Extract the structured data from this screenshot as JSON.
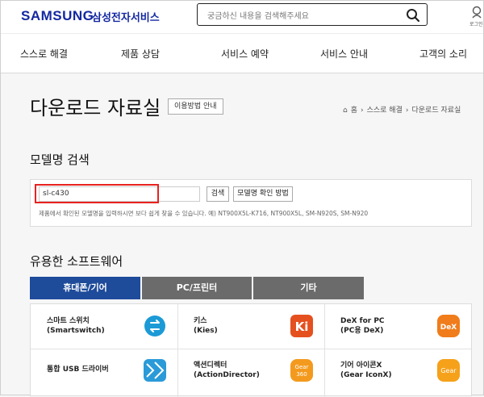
{
  "header": {
    "logo": "SAMSUNG",
    "logo_sub": "삼성전자서비스",
    "search_placeholder": "궁금하신 내용을 검색해주세요",
    "user_label": "로그인"
  },
  "nav": [
    "스스로 해결",
    "제품 상담",
    "서비스 예약",
    "서비스 안내",
    "고객의 소리"
  ],
  "page": {
    "title": "다운로드 자료실",
    "guide_button": "이용방법 안내",
    "breadcrumb": [
      "홈",
      "스스로 해결",
      "다운로드 자료실"
    ]
  },
  "model_search": {
    "title": "모델명 검색",
    "input_value": "sl-c430",
    "search_button": "검색",
    "check_button": "모델명 확인 방법",
    "hint": "제품에서 확인된 모델명을 입력하시면 보다 쉽게 찾을 수 있습니다. 예) NT900X5L-K716, NT900X5L, SM-N920S, SM-N920"
  },
  "software": {
    "title": "유용한 소프트웨어",
    "tabs": [
      "휴대폰/기어",
      "PC/프린터",
      "기타"
    ],
    "items": [
      {
        "name": "스마트 스위치\n(Smartswitch)",
        "icon": "smartswitch-icon",
        "color": "#1b9ad6"
      },
      {
        "name": "키스\n(Kies)",
        "icon": "kies-icon",
        "color": "#e5501f"
      },
      {
        "name": "DeX for PC\n(PC용 DeX)",
        "icon": "dex-icon",
        "color": "#f07c1b"
      },
      {
        "name": "통합 USB 드라이버",
        "icon": "usb-driver-icon",
        "color": "#1a8fd0"
      },
      {
        "name": "액션디렉터\n(ActionDirector)",
        "icon": "gear360-icon",
        "color": "#f39a1e"
      },
      {
        "name": "기어 아이콘X\n(Gear IconX)",
        "icon": "gear-iconx-icon",
        "color": "#f5a11a"
      }
    ]
  },
  "colors": {
    "brand": "#1428a0",
    "tab_active": "#1e4b9a",
    "tab_inactive": "#6b6b6b",
    "highlight": "#e8221f"
  }
}
